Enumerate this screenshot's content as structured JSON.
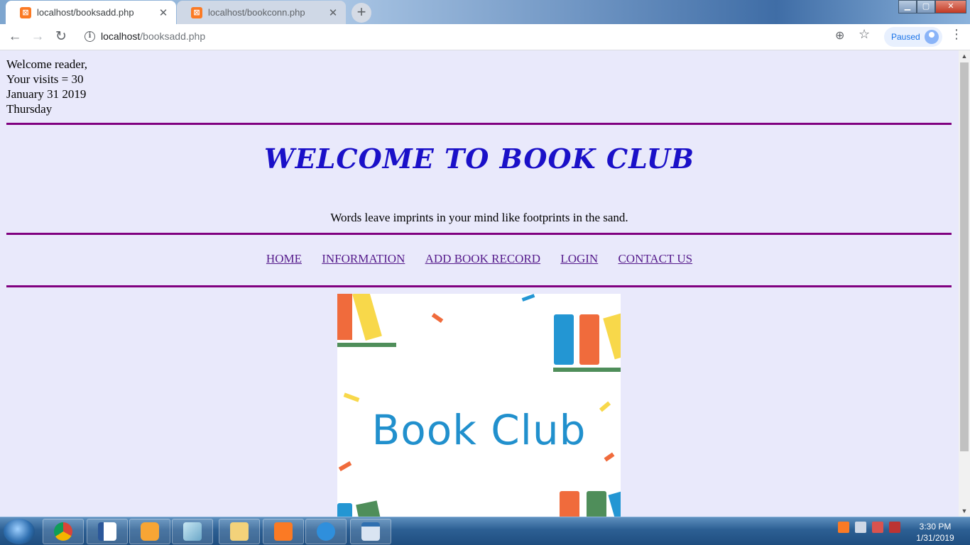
{
  "browser": {
    "tabs": [
      {
        "title": "localhost/booksadd.php",
        "active": true
      },
      {
        "title": "localhost/bookconn.php",
        "active": false
      }
    ],
    "url_host": "localhost",
    "url_path": "/booksadd.php",
    "profile_status": "Paused"
  },
  "page": {
    "greeting": "Welcome reader,",
    "visits": "Your visits = 30",
    "date": "January 31 2019",
    "weekday": "Thursday",
    "title": "WELCOME TO BOOK CLUB",
    "tagline": "Words leave imprints in your mind like footprints in the sand.",
    "nav": [
      "HOME",
      "INFORMATION",
      "ADD BOOK RECORD",
      "LOGIN",
      "CONTACT US"
    ],
    "banner_text": "Book Club"
  },
  "colors": {
    "page_background": "#e9e9fb",
    "rule": "#800080",
    "title": "#1a10c8",
    "link": "#551a8b",
    "banner_text": "#2190cd"
  },
  "taskbar": {
    "time": "3:30 PM",
    "date": "1/31/2019",
    "apps": [
      "chrome-icon",
      "word-icon",
      "media-player-icon",
      "notepad-icon",
      "explorer-icon",
      "xampp-icon",
      "internet-explorer-icon",
      "app-icon"
    ]
  }
}
